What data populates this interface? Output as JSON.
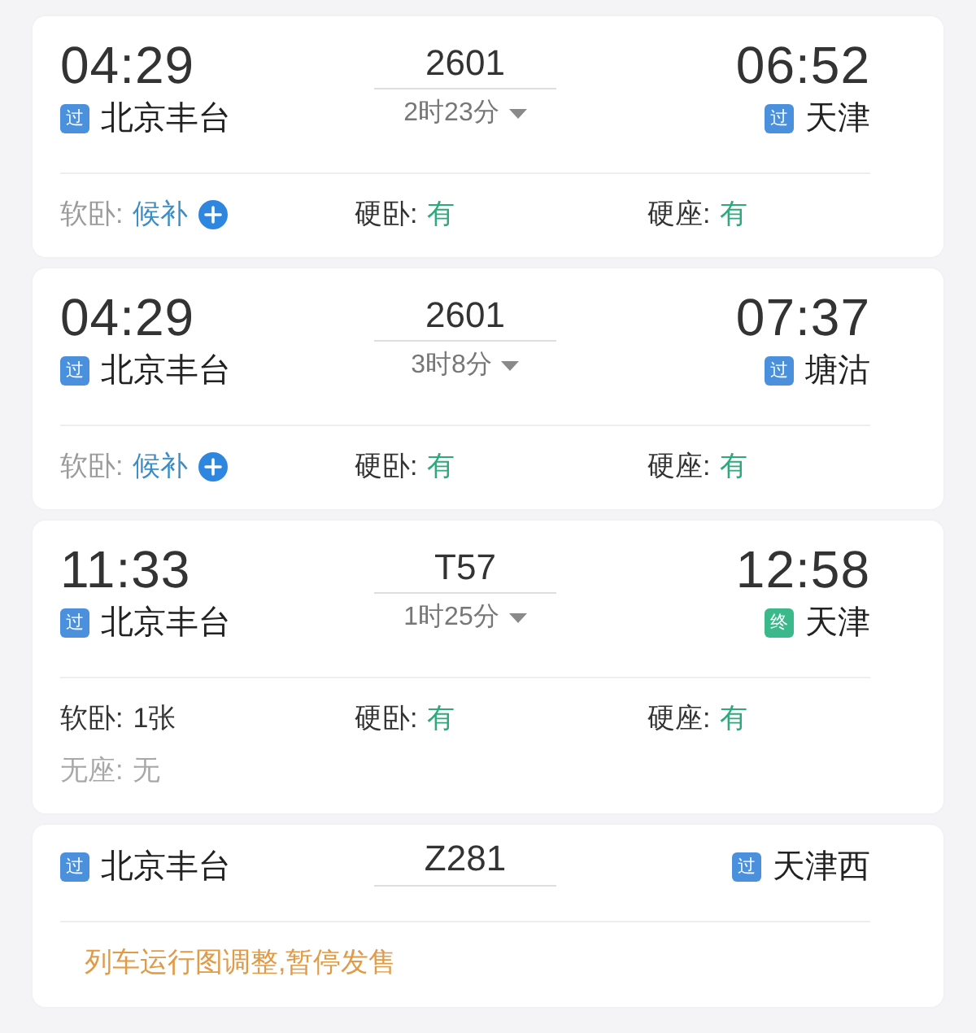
{
  "trains": [
    {
      "depart_time": "04:29",
      "from": {
        "tag": {
          "text": "过",
          "color": "#4a90dc"
        },
        "name": "北京丰台"
      },
      "number": "2601",
      "duration": "2时23分",
      "arrive_time": "06:52",
      "to": {
        "tag": {
          "text": "过",
          "color": "#4a90dc"
        },
        "name": "天津"
      },
      "seats": [
        {
          "label": "软卧:",
          "value": "候补",
          "kind": "waitlist"
        },
        {
          "label": "硬卧:",
          "value": "有",
          "kind": "available"
        },
        {
          "label": "硬座:",
          "value": "有",
          "kind": "available"
        }
      ]
    },
    {
      "depart_time": "04:29",
      "from": {
        "tag": {
          "text": "过",
          "color": "#4a90dc"
        },
        "name": "北京丰台"
      },
      "number": "2601",
      "duration": "3时8分",
      "arrive_time": "07:37",
      "to": {
        "tag": {
          "text": "过",
          "color": "#4a90dc"
        },
        "name": "塘沽"
      },
      "seats": [
        {
          "label": "软卧:",
          "value": "候补",
          "kind": "waitlist"
        },
        {
          "label": "硬卧:",
          "value": "有",
          "kind": "available"
        },
        {
          "label": "硬座:",
          "value": "有",
          "kind": "available"
        }
      ]
    },
    {
      "depart_time": "11:33",
      "from": {
        "tag": {
          "text": "过",
          "color": "#4a90dc"
        },
        "name": "北京丰台"
      },
      "number": "T57",
      "duration": "1时25分",
      "arrive_time": "12:58",
      "to": {
        "tag": {
          "text": "终",
          "color": "#3cb98a"
        },
        "name": "天津"
      },
      "seats": [
        {
          "label": "软卧:",
          "value": "1张",
          "kind": "count"
        },
        {
          "label": "硬卧:",
          "value": "有",
          "kind": "available"
        },
        {
          "label": "硬座:",
          "value": "有",
          "kind": "available"
        },
        {
          "label": "无座:",
          "value": "无",
          "kind": "none"
        }
      ]
    },
    {
      "from": {
        "tag": {
          "text": "过",
          "color": "#4a90dc"
        },
        "name": "北京丰台"
      },
      "number": "Z281",
      "to": {
        "tag": {
          "text": "过",
          "color": "#4a90dc"
        },
        "name": "天津西"
      },
      "notice": "列车运行图调整,暂停发售"
    }
  ]
}
